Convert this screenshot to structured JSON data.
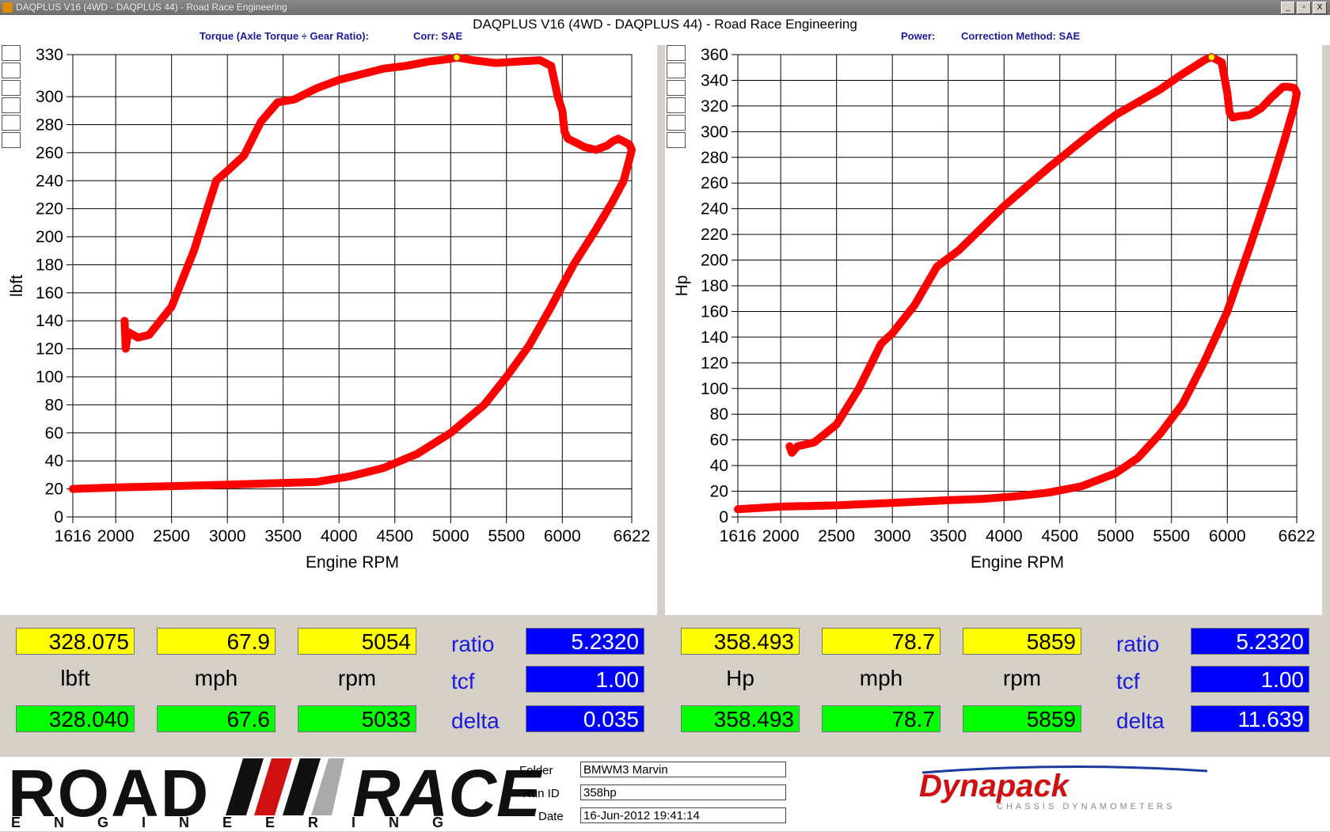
{
  "window": {
    "title": "DAQPLUS V16 (4WD - DAQPLUS 44) - Road Race Engineering",
    "buttons": [
      "_",
      "▫",
      "X"
    ]
  },
  "header": {
    "title": "DAQPLUS V16 (4WD - DAQPLUS 44) - Road Race Engineering",
    "left_label": "Torque (Axle Torque ÷ Gear Ratio):",
    "left_corr": "Corr: SAE",
    "right_label": "Power:",
    "right_corr": "Correction Method: SAE"
  },
  "colors": {
    "curve": "#ff0000",
    "swatches": [
      "#ff0000",
      "#00d000",
      "#0070c0",
      "#ff00ff",
      "#00ffff",
      "#e06820"
    ],
    "yellow": "#ffff00",
    "green": "#00ff00",
    "blue": "#0000ff"
  },
  "chart_data": [
    {
      "type": "line",
      "ylabel": "lbft",
      "xlabel": "Engine RPM",
      "xlim": [
        1616,
        6622
      ],
      "ylim": [
        0,
        330
      ],
      "x_ticks": [
        1616,
        2000,
        2500,
        3000,
        3500,
        4000,
        4500,
        5000,
        5500,
        6000,
        6622
      ],
      "y_ticks": [
        0,
        20,
        40,
        60,
        80,
        100,
        120,
        140,
        160,
        180,
        200,
        220,
        240,
        260,
        280,
        300,
        330
      ],
      "grid": true,
      "peak_marker": [
        5054,
        328
      ],
      "series": [
        {
          "x": [
            2080,
            2090,
            2110,
            2200,
            2300,
            2500,
            2700,
            2900,
            3000,
            3150,
            3300,
            3450,
            3600,
            3800,
            4000,
            4200,
            4400,
            4600,
            4800,
            5000,
            5054,
            5200,
            5400,
            5600,
            5800,
            5900,
            5960,
            6000,
            6020,
            6050,
            6100,
            6200,
            6300,
            6400,
            6450,
            6500,
            6550,
            6600,
            6622,
            6600,
            6550,
            6450,
            6300,
            6100,
            5900,
            5700,
            5500,
            5300,
            5000,
            4700,
            4400,
            4100,
            3800,
            3400,
            3000,
            2500,
            2000,
            1616
          ],
          "y": [
            140,
            120,
            132,
            128,
            130,
            150,
            190,
            240,
            247,
            258,
            282,
            296,
            298,
            306,
            312,
            316,
            320,
            322,
            325,
            327,
            328,
            326,
            324,
            325,
            326,
            322,
            300,
            290,
            275,
            270,
            268,
            264,
            262,
            265,
            268,
            270,
            268,
            266,
            262,
            255,
            240,
            225,
            205,
            180,
            150,
            122,
            100,
            80,
            60,
            45,
            35,
            29,
            25,
            24,
            23,
            22,
            21,
            20
          ]
        }
      ]
    },
    {
      "type": "line",
      "ylabel": "Hp",
      "xlabel": "Engine RPM",
      "xlim": [
        1616,
        6622
      ],
      "ylim": [
        0,
        360
      ],
      "x_ticks": [
        1616,
        2000,
        2500,
        3000,
        3500,
        4000,
        4500,
        5000,
        5500,
        6000,
        6622
      ],
      "y_ticks": [
        0,
        20,
        40,
        60,
        80,
        100,
        120,
        140,
        160,
        180,
        200,
        220,
        240,
        260,
        280,
        300,
        320,
        340,
        360
      ],
      "grid": true,
      "peak_marker": [
        5859,
        358
      ],
      "series": [
        {
          "x": [
            2080,
            2100,
            2150,
            2300,
            2500,
            2700,
            2900,
            3000,
            3200,
            3400,
            3600,
            3800,
            4000,
            4200,
            4400,
            4600,
            4800,
            5000,
            5200,
            5400,
            5600,
            5800,
            5859,
            5950,
            6000,
            6020,
            6050,
            6100,
            6200,
            6300,
            6400,
            6500,
            6550,
            6600,
            6622,
            6600,
            6500,
            6400,
            6200,
            6000,
            5800,
            5600,
            5400,
            5200,
            5000,
            4700,
            4400,
            4100,
            3800,
            3500,
            3000,
            2500,
            2000,
            1616
          ],
          "y": [
            55,
            50,
            55,
            58,
            72,
            100,
            135,
            143,
            165,
            195,
            208,
            225,
            242,
            257,
            272,
            286,
            300,
            313,
            323,
            333,
            345,
            356,
            358,
            354,
            330,
            315,
            311,
            312,
            313,
            318,
            327,
            335,
            335,
            334,
            330,
            320,
            290,
            262,
            210,
            160,
            122,
            88,
            65,
            46,
            34,
            24,
            19,
            16,
            14,
            13,
            11,
            9,
            8,
            6
          ]
        }
      ]
    }
  ],
  "readouts": {
    "left": {
      "values_yellow": [
        "328.075",
        "67.9",
        "5054"
      ],
      "units": [
        "lbft",
        "mph",
        "rpm"
      ],
      "values_green": [
        "328.040",
        "67.6",
        "5033"
      ],
      "labels": [
        "ratio",
        "tcf",
        "delta"
      ],
      "blue_values": [
        "5.2320",
        "1.00",
        "0.035"
      ]
    },
    "right": {
      "values_yellow": [
        "358.493",
        "78.7",
        "5859"
      ],
      "units": [
        "Hp",
        "mph",
        "rpm"
      ],
      "values_green": [
        "358.493",
        "78.7",
        "5859"
      ],
      "labels": [
        "ratio",
        "tcf",
        "delta"
      ],
      "blue_values": [
        "5.2320",
        "1.00",
        "11.639"
      ]
    }
  },
  "footer": {
    "logo_road": "ROAD",
    "logo_race": "RACE",
    "logo_engineering": "ENGINEERING",
    "folder_label": "Folder",
    "folder_value": "BMWM3 Marvin",
    "runid_label": "Run ID",
    "runid_value": "358hp",
    "date_label": "Date",
    "date_value": "16-Jun-2012  19:41:14",
    "brand": "Dynapack",
    "brand_sub": "CHASSIS DYNAMOMETERS"
  }
}
